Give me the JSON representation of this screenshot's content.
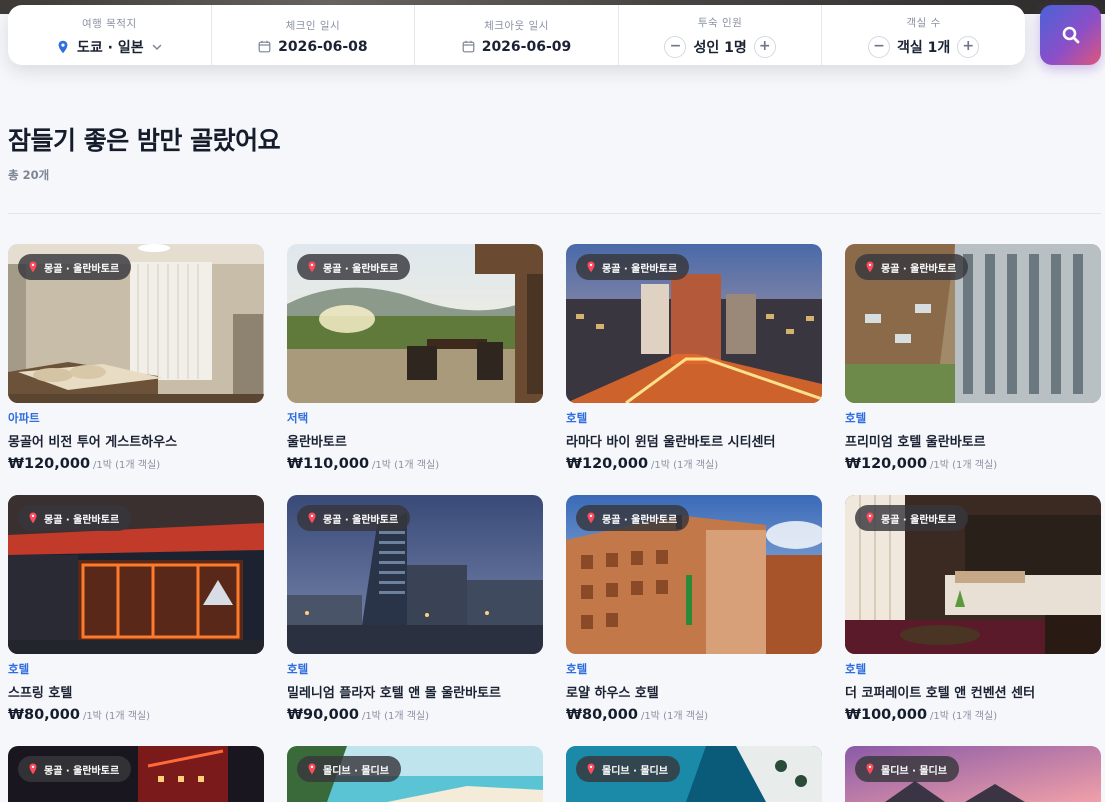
{
  "search": {
    "destination": {
      "label": "여행 목적지",
      "value": "도쿄 · 일본"
    },
    "checkin": {
      "label": "체크인 일시",
      "value": "2026-06-08"
    },
    "checkout": {
      "label": "체크아웃 일시",
      "value": "2026-06-09"
    },
    "guests": {
      "label": "투숙 인원",
      "value": "성인 1명",
      "minus": "−",
      "plus": "+"
    },
    "rooms": {
      "label": "객실 수",
      "value": "객실 1개",
      "minus": "−",
      "plus": "+"
    },
    "search_icon": "search-icon"
  },
  "heading": {
    "title": "잠들기 좋은 밤만 골랐어요",
    "count": "총 20개"
  },
  "cards": [
    {
      "location": "몽골 · 울란바토르",
      "type": "아파트",
      "name": "몽골어 비전 투어 게스트하우스",
      "price": "₩120,000",
      "unit": "/1박 (1개 객실)"
    },
    {
      "location": "몽골 · 울란바토르",
      "type": "저택",
      "name": "울란바토르",
      "price": "₩110,000",
      "unit": "/1박 (1개 객실)"
    },
    {
      "location": "몽골 · 울란바토르",
      "type": "호텔",
      "name": "라마다 바이 윈덤 울란바토르 시티센터",
      "price": "₩120,000",
      "unit": "/1박 (1개 객실)"
    },
    {
      "location": "몽골 · 울란바토르",
      "type": "호텔",
      "name": "프리미엄 호텔 울란바토르",
      "price": "₩120,000",
      "unit": "/1박 (1개 객실)"
    },
    {
      "location": "몽골 · 울란바토르",
      "type": "호텔",
      "name": "스프링 호텔",
      "price": "₩80,000",
      "unit": "/1박 (1개 객실)"
    },
    {
      "location": "몽골 · 울란바토르",
      "type": "호텔",
      "name": "밀레니엄 플라자 호텔 앤 몰 울란바토르",
      "price": "₩90,000",
      "unit": "/1박 (1개 객실)"
    },
    {
      "location": "몽골 · 울란바토르",
      "type": "호텔",
      "name": "로얄 하우스 호텔",
      "price": "₩80,000",
      "unit": "/1박 (1개 객실)"
    },
    {
      "location": "몽골 · 울란바토르",
      "type": "호텔",
      "name": "더 코퍼레이트 호텔 앤 컨벤션 센터",
      "price": "₩100,000",
      "unit": "/1박 (1개 객실)"
    },
    {
      "location": "몽골 · 울란바토르"
    },
    {
      "location": "몰디브 · 몰디브"
    },
    {
      "location": "몰디브 · 몰디브"
    },
    {
      "location": "몰디브 · 몰디브"
    }
  ],
  "colors": {
    "accent": "#2e6ee0",
    "search_gradient_start": "#4a63d8",
    "search_gradient_end": "#e0567a"
  }
}
